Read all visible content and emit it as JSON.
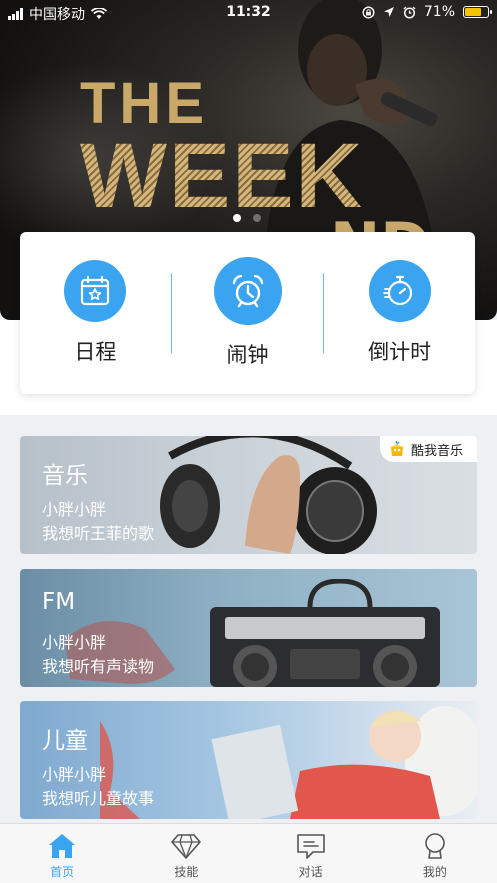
{
  "status_bar": {
    "carrier": "中国移动",
    "time": "11:32",
    "battery": "71%",
    "battery_level": 0.71
  },
  "banner": {
    "text_line1": "THE",
    "text_line2": "WEEK",
    "text_line3": "ND",
    "page_count": 2,
    "active_page": 0
  },
  "quick_actions": [
    {
      "label": "日程",
      "icon": "calendar-icon"
    },
    {
      "label": "闹钟",
      "icon": "alarm-clock-icon"
    },
    {
      "label": "倒计时",
      "icon": "stopwatch-icon"
    }
  ],
  "cards": {
    "music": {
      "title": "音乐",
      "line1": "小胖小胖",
      "line2": "我想听王菲的歌",
      "badge": "酷我音乐",
      "badge_icon": "kuwo-logo-icon"
    },
    "fm": {
      "title": "FM",
      "line1": "小胖小胖",
      "line2": "我想听有声读物"
    },
    "kids": {
      "title": "儿童",
      "line1": "小胖小胖",
      "line2": "我想听儿童故事"
    }
  },
  "tabbar": [
    {
      "label": "首页",
      "icon": "home-icon",
      "active": true
    },
    {
      "label": "技能",
      "icon": "diamond-icon",
      "active": false
    },
    {
      "label": "对话",
      "icon": "chat-icon",
      "active": false
    },
    {
      "label": "我的",
      "icon": "profile-icon",
      "active": false
    }
  ],
  "colors": {
    "accent": "#3aa4f0",
    "banner_gold": "#c9a96a"
  }
}
